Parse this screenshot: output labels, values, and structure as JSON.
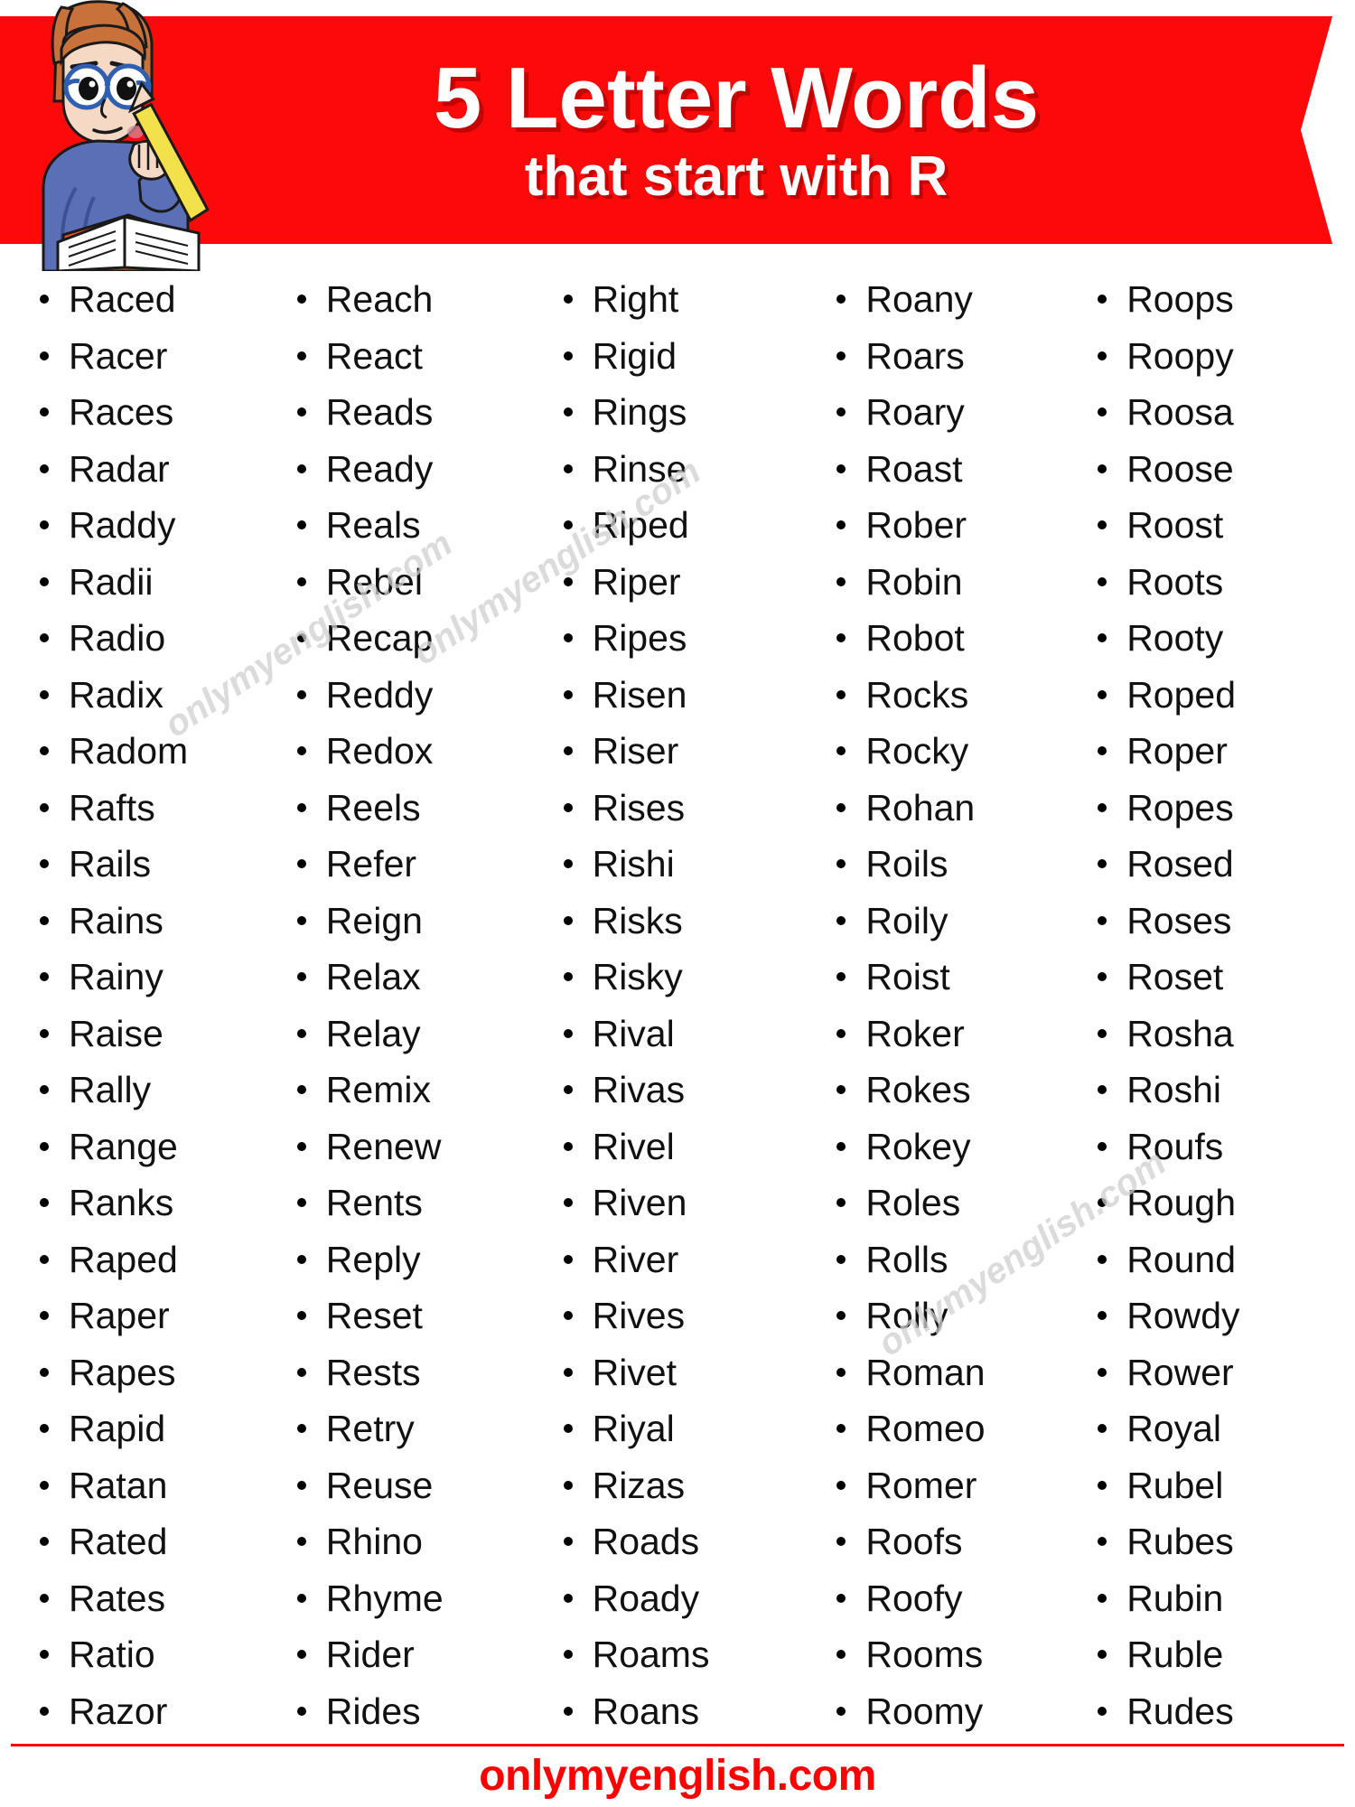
{
  "header": {
    "title_main": "5 Letter Words",
    "title_sub": "that start with R",
    "banner_color": "#FC0A0A",
    "title_color": "#FFFFFF",
    "mascot_icon": "student-reading-book-icon"
  },
  "watermarks": [
    {
      "text": "onlymyenglish.com"
    },
    {
      "text": "onlymyenglish.com"
    },
    {
      "text": "onlymyenglish.com"
    }
  ],
  "columns": [
    {
      "id": "column-1",
      "words": [
        "Raced",
        "Racer",
        "Races",
        "Radar",
        "Raddy",
        "Radii",
        "Radio",
        "Radix",
        "Radom",
        "Rafts",
        "Rails",
        "Rains",
        "Rainy",
        "Raise",
        "Rally",
        "Range",
        "Ranks",
        "Raped",
        "Raper",
        "Rapes",
        "Rapid",
        "Ratan",
        "Rated",
        "Rates",
        "Ratio",
        "Razor"
      ]
    },
    {
      "id": "column-2",
      "words": [
        "Reach",
        "React",
        "Reads",
        "Ready",
        "Reals",
        "Rebel",
        "Recap",
        "Reddy",
        "Redox",
        "Reels",
        "Refer",
        "Reign",
        "Relax",
        "Relay",
        "Remix",
        "Renew",
        "Rents",
        "Reply",
        "Reset",
        "Rests",
        "Retry",
        "Reuse",
        "Rhino",
        "Rhyme",
        "Rider",
        "Rides"
      ]
    },
    {
      "id": "column-3",
      "words": [
        "Right",
        "Rigid",
        "Rings",
        "Rinse",
        "Riped",
        "Riper",
        "Ripes",
        "Risen",
        "Riser",
        "Rises",
        "Rishi",
        "Risks",
        "Risky",
        "Rival",
        "Rivas",
        "Rivel",
        "Riven",
        "River",
        "Rives",
        "Rivet",
        "Riyal",
        "Rizas",
        "Roads",
        "Roady",
        "Roams",
        "Roans"
      ]
    },
    {
      "id": "column-4",
      "words": [
        "Roany",
        "Roars",
        "Roary",
        "Roast",
        "Rober",
        "Robin",
        "Robot",
        "Rocks",
        "Rocky",
        "Rohan",
        "Roils",
        "Roily",
        "Roist",
        "Roker",
        "Rokes",
        "Rokey",
        "Roles",
        "Rolls",
        "Rolly",
        "Roman",
        "Romeo",
        "Romer",
        "Roofs",
        "Roofy",
        "Rooms",
        "Roomy"
      ]
    },
    {
      "id": "column-5",
      "words": [
        "Roops",
        "Roopy",
        "Roosa",
        "Roose",
        "Roost",
        "Roots",
        "Rooty",
        "Roped",
        "Roper",
        "Ropes",
        "Rosed",
        "Roses",
        "Roset",
        "Rosha",
        "Roshi",
        "Roufs",
        "Rough",
        "Round",
        "Rowdy",
        "Rower",
        "Royal",
        "Rubel",
        "Rubes",
        "Rubin",
        "Ruble",
        "Rudes"
      ]
    }
  ],
  "footer": {
    "site": "onlymyenglish.com",
    "color": "#FF0000"
  }
}
